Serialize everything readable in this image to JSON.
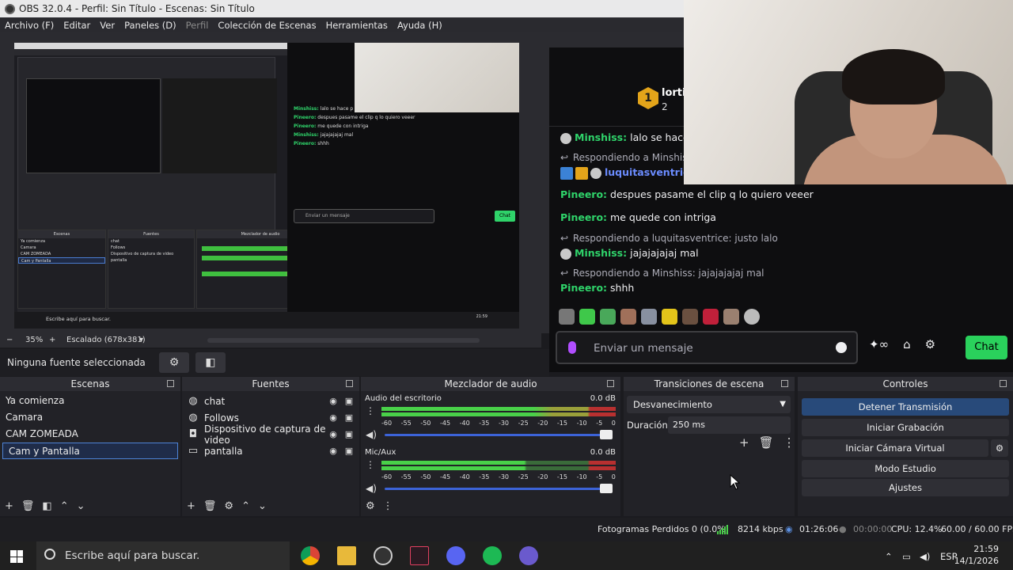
{
  "window": {
    "title": "OBS 32.0.4 - Perfil: Sin Título - Escenas: Sin Título"
  },
  "menu": {
    "items": [
      "Archivo (F)",
      "Editar",
      "Ver",
      "Paneles (D)",
      "Perfil",
      "Colección de Escenas",
      "Herramientas",
      "Ayuda (H)"
    ]
  },
  "preview": {
    "zoom": "35%",
    "scale_label": "Escalado (678x381)",
    "nested_chat": {
      "lines": [
        {
          "user": "Minshiss:",
          "text": "lalo se hace p"
        },
        {
          "user": "Pineero:",
          "text": "despues pasame el clip q lo quiero veeer"
        },
        {
          "user": "Pineero:",
          "text": "me quede con intriga"
        },
        {
          "user": "Minshiss:",
          "text": "jajajajajaj mal"
        },
        {
          "user": "Pineero:",
          "text": "shhh"
        }
      ],
      "input_placeholder": "Enviar un mensaje",
      "send": "Chat"
    }
  },
  "chat": {
    "leader": {
      "rank": "1",
      "name": "lortiz",
      "count": "2"
    },
    "lines": {
      "l0": {
        "user": "Minshiss:",
        "text": "lalo se hace p"
      },
      "l1": {
        "text": "Respondiendo a Minshiss: jajajajajaj mal"
      },
      "l1b": {
        "user": "luquitasventrice"
      },
      "l2": {
        "user": "Pineero:",
        "text": "despues pasame el clip q lo quiero veeer"
      },
      "l3": {
        "user": "Pineero:",
        "text": "me quede con intriga"
      },
      "l4": {
        "text": "Respondiendo a luquitasventrice: justo lalo"
      },
      "l5": {
        "user": "Minshiss:",
        "text": "jajajajajaj mal"
      },
      "l6": {
        "text": "Respondiendo a Minshiss: jajajajajaj mal"
      },
      "l7": {
        "user": "Pineero:",
        "text": "shhh"
      }
    },
    "input_placeholder": "Enviar un mensaje",
    "send_label": "Chat"
  },
  "source_toolbar": {
    "label": "Ninguna fuente seleccionada"
  },
  "docks": {
    "scenes": {
      "title": "Escenas",
      "items": [
        "Ya comienza",
        "Camara",
        "CAM ZOMEADA",
        "Cam y Pantalla"
      ]
    },
    "sources": {
      "title": "Fuentes",
      "items": [
        "chat",
        "Follows",
        "Dispositivo de captura de video",
        "pantalla"
      ]
    },
    "mixer": {
      "title": "Mezclador de audio",
      "channels": [
        {
          "name": "Audio del escritorio",
          "db": "0.0 dB"
        },
        {
          "name": "Mic/Aux",
          "db": "0.0 dB"
        }
      ],
      "scale": [
        "-60",
        "-55",
        "-50",
        "-45",
        "-40",
        "-35",
        "-30",
        "-25",
        "-20",
        "-15",
        "-10",
        "-5",
        "0"
      ]
    },
    "transitions": {
      "title": "Transiciones de escena",
      "selected": "Desvanecimiento",
      "duration_label": "Duración",
      "duration_value": "250 ms"
    },
    "controls": {
      "title": "Controles",
      "buttons": [
        "Detener Transmisión",
        "Iniciar Grabación",
        "Iniciar Cámara Virtual",
        "Modo Estudio",
        "Ajustes"
      ]
    }
  },
  "status": {
    "dropped": "Fotogramas Perdidos 0 (0.0%)",
    "bitrate": "8214 kbps",
    "stream_time": "01:26:06",
    "rec_time": "00:00:00",
    "cpu": "CPU: 12.4%",
    "fps": "60.00 / 60.00 FPS"
  },
  "taskbar": {
    "search_placeholder": "Escribe aquí para buscar.",
    "lang": "ESP",
    "time": "21:59",
    "date": "14/1/2026"
  },
  "colors": {
    "accent_green": "#2ad15c",
    "selection_blue": "#4d83d6",
    "twitch_purple": "#b14eff"
  }
}
